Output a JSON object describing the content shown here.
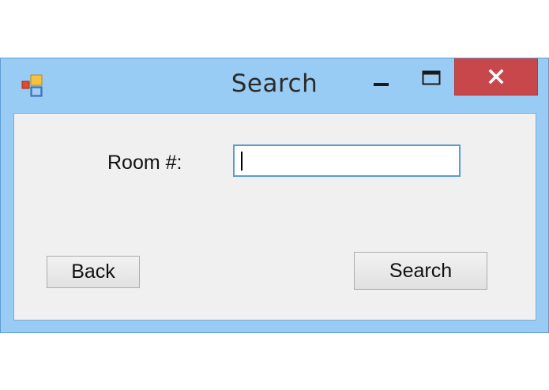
{
  "window": {
    "title": "Search",
    "controls": {
      "minimize": "minimize-icon",
      "maximize": "maximize-icon",
      "close": "close-icon"
    }
  },
  "form": {
    "room_label": "Room #:",
    "room_value": "",
    "back_label": "Back",
    "search_label": "Search"
  },
  "colors": {
    "frame": "#99ccf4",
    "close_button": "#c7474a",
    "client_background": "#f0f0f0",
    "input_border": "#5b9bd5"
  }
}
